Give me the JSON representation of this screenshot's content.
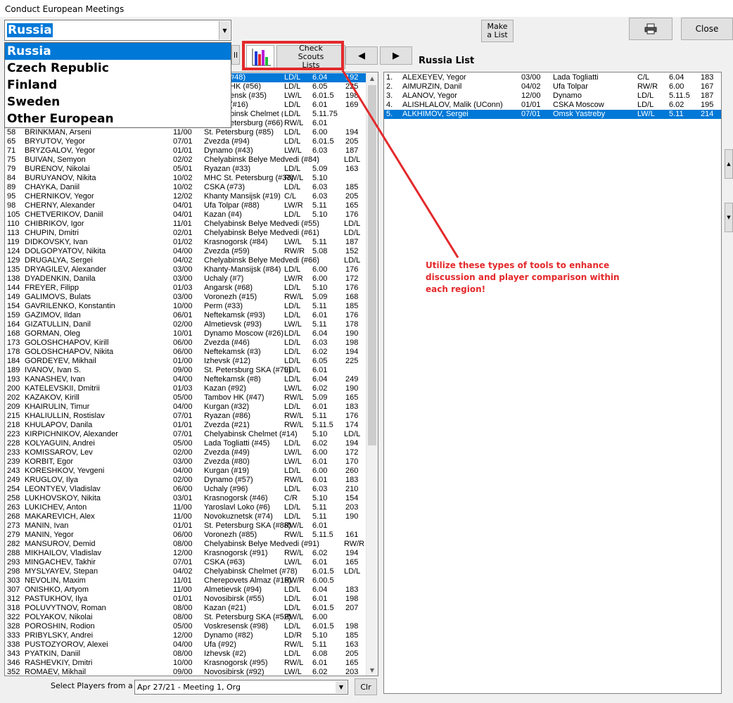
{
  "window": {
    "title": "Conduct European Meetings"
  },
  "region_combo": {
    "value": "Russia",
    "options": [
      "Russia",
      "Czech Republic",
      "Finland",
      "Sweden",
      "Other European"
    ]
  },
  "toolbar": {
    "make_list": "Make a List",
    "print_icon": "printer-icon",
    "close": "Close",
    "check_scouts": "Check Scouts Lists",
    "prev_icon": "triangle-left-icon",
    "next_icon": "triangle-right-icon",
    "all_label": "ll"
  },
  "colors": {
    "selection": "#0078d7",
    "annotation": "#e3292b"
  },
  "left_list": {
    "partial_rows": [
      {
        "team": "#48)",
        "pos": "LD/L",
        "ht": "6.04",
        "wt": "192",
        "selected": true
      },
      {
        "team": "HK (#56)",
        "pos": "LD/L",
        "ht": "6.05",
        "wt": "225"
      },
      {
        "team": "ensk (#35)",
        "pos": "LW/L",
        "ht": "6.01.5",
        "wt": "198"
      },
      {
        "team": "(#16)",
        "pos": "LD/L",
        "ht": "6.01",
        "wt": "169"
      },
      {
        "team": "binsk Chelmet (#96)",
        "pos": "LD/L",
        "ht": "5.11.75",
        "wt": ""
      },
      {
        "team": "etersburg (#66)",
        "pos": "RW/L",
        "ht": "6.01",
        "wt": ""
      }
    ],
    "rows": [
      {
        "num": "58",
        "name": "BRINKMAN, Arseni",
        "dob": "11/00",
        "team": "St. Petersburg (#85)",
        "pos": "LD/L",
        "ht": "6.00",
        "wt": "194"
      },
      {
        "num": "65",
        "name": "BRYUTOV, Yegor",
        "dob": "07/01",
        "team": "Zvezda (#94)",
        "pos": "LD/L",
        "ht": "6.01.5",
        "wt": "205"
      },
      {
        "num": "71",
        "name": "BRYZGALOV, Yegor",
        "dob": "01/01",
        "team": "Dynamo (#43)",
        "pos": "LW/L",
        "ht": "6.03",
        "wt": "187"
      },
      {
        "num": "75",
        "name": "BUIVAN, Semyon",
        "dob": "02/02",
        "team": "Chelyabinsk Belye Medvedi (#84)",
        "pos": "LD/L",
        "ht": "",
        "wt": ""
      },
      {
        "num": "79",
        "name": "BURENOV, Nikolai",
        "dob": "05/01",
        "team": "Ryazan (#33)",
        "pos": "LD/L",
        "ht": "5.09",
        "wt": "163"
      },
      {
        "num": "84",
        "name": "BURUYANOV, Nikita",
        "dob": "10/02",
        "team": "MHC St. Petersburg (#33)",
        "pos": "RW/L",
        "ht": "5.10",
        "wt": ""
      },
      {
        "num": "89",
        "name": "CHAYKA, Daniil",
        "dob": "10/02",
        "team": "CSKA (#73)",
        "pos": "LD/L",
        "ht": "6.03",
        "wt": "185"
      },
      {
        "num": "95",
        "name": "CHERNIKOV, Yegor",
        "dob": "12/02",
        "team": "Khanty Mansijsk (#19)",
        "pos": "C/L",
        "ht": "6.03",
        "wt": "205"
      },
      {
        "num": "98",
        "name": "CHERNY, Alexander",
        "dob": "04/01",
        "team": "Ufa Tolpar (#88)",
        "pos": "LW/R",
        "ht": "5.11",
        "wt": "165"
      },
      {
        "num": "105",
        "name": "CHETVERIKOV, Daniil",
        "dob": "04/01",
        "team": "Kazan (#4)",
        "pos": "LD/L",
        "ht": "5.10",
        "wt": "176"
      },
      {
        "num": "110",
        "name": "CHIBRIKOV, Igor",
        "dob": "11/01",
        "team": "Chelyabinsk Belye Medvedi (#55)",
        "pos": "LD/L",
        "ht": "",
        "wt": ""
      },
      {
        "num": "113",
        "name": "CHUPIN, Dmitri",
        "dob": "02/01",
        "team": "Chelyabinsk Belye Medvedi (#61)",
        "pos": "LD/L",
        "ht": "",
        "wt": ""
      },
      {
        "num": "119",
        "name": "DIDKOVSKY, Ivan",
        "dob": "01/02",
        "team": "Krasnogorsk (#84)",
        "pos": "LW/L",
        "ht": "5.11",
        "wt": "187"
      },
      {
        "num": "124",
        "name": "DOLGOPYATOV, Nikita",
        "dob": "04/00",
        "team": "Zvezda (#59)",
        "pos": "RW/R",
        "ht": "5.08",
        "wt": "152"
      },
      {
        "num": "129",
        "name": "DRUGALYA, Sergei",
        "dob": "04/02",
        "team": "Chelyabinsk Belye Medvedi (#66)",
        "pos": "LD/L",
        "ht": "",
        "wt": ""
      },
      {
        "num": "135",
        "name": "DRYAGILEV, Alexander",
        "dob": "03/00",
        "team": "Khanty-Mansijsk (#84)",
        "pos": "LD/L",
        "ht": "6.00",
        "wt": "176"
      },
      {
        "num": "138",
        "name": "DYADENKIN, Danila",
        "dob": "03/00",
        "team": "Uchaly (#7)",
        "pos": "LW/R",
        "ht": "6.00",
        "wt": "172"
      },
      {
        "num": "144",
        "name": "FREYER, Filipp",
        "dob": "01/03",
        "team": "Angarsk (#68)",
        "pos": "LD/L",
        "ht": "5.10",
        "wt": "176"
      },
      {
        "num": "149",
        "name": "GALIMOVS, Bulats",
        "dob": "03/00",
        "team": "Voronezh (#15)",
        "pos": "RW/L",
        "ht": "5.09",
        "wt": "168"
      },
      {
        "num": "154",
        "name": "GAVRILENKO, Konstantin",
        "dob": "10/00",
        "team": "Perm (#33)",
        "pos": "LD/L",
        "ht": "5.11",
        "wt": "185"
      },
      {
        "num": "159",
        "name": "GAZIMOV, Ildan",
        "dob": "06/01",
        "team": "Neftekamsk (#93)",
        "pos": "LD/L",
        "ht": "6.01",
        "wt": "176"
      },
      {
        "num": "164",
        "name": "GIZATULLIN, Danil",
        "dob": "02/00",
        "team": "Almetievsk (#93)",
        "pos": "LW/L",
        "ht": "5.11",
        "wt": "178"
      },
      {
        "num": "168",
        "name": "GORMAN, Oleg",
        "dob": "10/01",
        "team": "Dynamo Moscow (#26)",
        "pos": "LD/L",
        "ht": "6.04",
        "wt": "190"
      },
      {
        "num": "173",
        "name": "GOLOSHCHAPOV, Kirill",
        "dob": "06/00",
        "team": "Zvezda (#46)",
        "pos": "LD/L",
        "ht": "6.03",
        "wt": "198"
      },
      {
        "num": "178",
        "name": "GOLOSHCHAPOV, Nikita",
        "dob": "06/00",
        "team": "Neftekamsk (#3)",
        "pos": "LD/L",
        "ht": "6.02",
        "wt": "194"
      },
      {
        "num": "184",
        "name": "GORDEYEV, Mikhail",
        "dob": "01/00",
        "team": "Izhevsk (#12)",
        "pos": "LD/L",
        "ht": "6.05",
        "wt": "225"
      },
      {
        "num": "189",
        "name": "IVANOV, Ivan S.",
        "dob": "09/00",
        "team": "St. Petersburg SKA (#79)",
        "pos": "LD/L",
        "ht": "6.01",
        "wt": ""
      },
      {
        "num": "193",
        "name": "KANASHEV, Ivan",
        "dob": "04/00",
        "team": "Neftekamsk (#8)",
        "pos": "LD/L",
        "ht": "6.04",
        "wt": "249"
      },
      {
        "num": "200",
        "name": "KATELEVSKII, Dmitrii",
        "dob": "01/03",
        "team": "Kazan (#92)",
        "pos": "LW/L",
        "ht": "6.02",
        "wt": "190"
      },
      {
        "num": "202",
        "name": "KAZAKOV, Kirill",
        "dob": "05/00",
        "team": "Tambov HK (#47)",
        "pos": "RW/L",
        "ht": "5.09",
        "wt": "165"
      },
      {
        "num": "209",
        "name": "KHAIRULIN, Timur",
        "dob": "04/00",
        "team": "Kurgan (#32)",
        "pos": "LD/L",
        "ht": "6.01",
        "wt": "183"
      },
      {
        "num": "215",
        "name": "KHALIULLIN, Rostislav",
        "dob": "07/01",
        "team": "Ryazan (#86)",
        "pos": "RW/L",
        "ht": "5.11",
        "wt": "176"
      },
      {
        "num": "218",
        "name": "KHULAPOV, Danila",
        "dob": "01/01",
        "team": "Zvezda (#21)",
        "pos": "RW/L",
        "ht": "5.11.5",
        "wt": "174"
      },
      {
        "num": "223",
        "name": "KIRPICHNIKOV, Alexander",
        "dob": "07/01",
        "team": "Chelyabinsk Chelmet (#14)",
        "pos": "LD/L",
        "ht": "5.10",
        "wt": ""
      },
      {
        "num": "228",
        "name": "KOLYAGUIN, Andrei",
        "dob": "05/00",
        "team": "Lada Togliatti (#45)",
        "pos": "LD/L",
        "ht": "6.02",
        "wt": "194"
      },
      {
        "num": "233",
        "name": "KOMISSAROV, Lev",
        "dob": "02/00",
        "team": "Zvezda (#49)",
        "pos": "LW/L",
        "ht": "6.00",
        "wt": "172"
      },
      {
        "num": "239",
        "name": "KORBIT, Egor",
        "dob": "03/00",
        "team": "Zvezda (#80)",
        "pos": "LW/L",
        "ht": "6.01",
        "wt": "170"
      },
      {
        "num": "243",
        "name": "KORESHKOV, Yevgeni",
        "dob": "04/00",
        "team": "Kurgan (#19)",
        "pos": "LD/L",
        "ht": "6.00",
        "wt": "260"
      },
      {
        "num": "249",
        "name": "KRUGLOV, Ilya",
        "dob": "02/00",
        "team": "Dynamo (#57)",
        "pos": "RW/L",
        "ht": "6.01",
        "wt": "183"
      },
      {
        "num": "254",
        "name": "LEONTYEV, Vladislav",
        "dob": "06/00",
        "team": "Uchaly (#96)",
        "pos": "LD/L",
        "ht": "6.03",
        "wt": "210"
      },
      {
        "num": "258",
        "name": "LUKHOVSKOY, Nikita",
        "dob": "03/01",
        "team": "Krasnogorsk (#46)",
        "pos": "C/R",
        "ht": "5.10",
        "wt": "154"
      },
      {
        "num": "263",
        "name": "LUKICHEV, Anton",
        "dob": "11/00",
        "team": "Yaroslavl Loko (#6)",
        "pos": "LD/L",
        "ht": "5.11",
        "wt": "203"
      },
      {
        "num": "268",
        "name": "MAKAREVICH, Alex",
        "dob": "11/00",
        "team": "Novokuznetsk (#74)",
        "pos": "LD/L",
        "ht": "5.11",
        "wt": "190"
      },
      {
        "num": "273",
        "name": "MANIN, Ivan",
        "dob": "01/01",
        "team": "St. Petersburg SKA (#88)",
        "pos": "RW/L",
        "ht": "6.01",
        "wt": ""
      },
      {
        "num": "279",
        "name": "MANIN, Yegor",
        "dob": "06/00",
        "team": "Voronezh (#85)",
        "pos": "RW/L",
        "ht": "5.11.5",
        "wt": "161"
      },
      {
        "num": "282",
        "name": "MANSUROV, Demid",
        "dob": "08/00",
        "team": "Chelyabinsk Belye Medvedi (#91)",
        "pos": "RW/R",
        "ht": "",
        "wt": ""
      },
      {
        "num": "288",
        "name": "MIKHAILOV, Vladislav",
        "dob": "12/00",
        "team": "Krasnogorsk (#91)",
        "pos": "RW/L",
        "ht": "6.02",
        "wt": "194"
      },
      {
        "num": "293",
        "name": "MINGACHEV, Takhir",
        "dob": "07/01",
        "team": "CSKA (#63)",
        "pos": "LW/L",
        "ht": "6.01",
        "wt": "165"
      },
      {
        "num": "298",
        "name": "MYSLYAYEV, Stepan",
        "dob": "04/02",
        "team": "Chelyabinsk Chelmet (#78)",
        "pos": "LD/L",
        "ht": "6.01.5",
        "wt": ""
      },
      {
        "num": "303",
        "name": "NEVOLIN, Maxim",
        "dob": "11/01",
        "team": "Cherepovets Almaz (#16)",
        "pos": "RW/R",
        "ht": "6.00.5",
        "wt": ""
      },
      {
        "num": "307",
        "name": "ONISHKO, Artyom",
        "dob": "11/00",
        "team": "Almetievsk (#94)",
        "pos": "LD/L",
        "ht": "6.04",
        "wt": "183"
      },
      {
        "num": "312",
        "name": "PASTUKHOV, Ilya",
        "dob": "01/01",
        "team": "Novosibirsk (#55)",
        "pos": "LD/L",
        "ht": "6.01",
        "wt": "198"
      },
      {
        "num": "318",
        "name": "POLUVYTNOV, Roman",
        "dob": "08/00",
        "team": "Kazan (#21)",
        "pos": "LD/L",
        "ht": "6.01.5",
        "wt": "207"
      },
      {
        "num": "322",
        "name": "POLYAKOV, Nikolai",
        "dob": "08/00",
        "team": "St. Petersburg SKA (#52)",
        "pos": "RW/L",
        "ht": "6.00",
        "wt": ""
      },
      {
        "num": "328",
        "name": "POROSHIN, Rodion",
        "dob": "05/00",
        "team": "Voskresensk (#98)",
        "pos": "LD/L",
        "ht": "6.01.5",
        "wt": "198"
      },
      {
        "num": "333",
        "name": "PRIBYLSKY, Andrei",
        "dob": "12/00",
        "team": "Dynamo (#82)",
        "pos": "LD/R",
        "ht": "5.10",
        "wt": "185"
      },
      {
        "num": "338",
        "name": "PUSTOZYOROV, Alexei",
        "dob": "04/00",
        "team": "Ufa (#92)",
        "pos": "RW/L",
        "ht": "5.11",
        "wt": "163"
      },
      {
        "num": "343",
        "name": "PYATKIN, Daniil",
        "dob": "08/00",
        "team": "Izhevsk (#2)",
        "pos": "LD/L",
        "ht": "6.08",
        "wt": "205"
      },
      {
        "num": "346",
        "name": "RASHEVKIY, Dmitri",
        "dob": "10/00",
        "team": "Krasnogorsk (#95)",
        "pos": "RW/L",
        "ht": "6.01",
        "wt": "165"
      },
      {
        "num": "352",
        "name": "ROMAEV, Mikhail",
        "dob": "09/00",
        "team": "Novosibirsk (#92)",
        "pos": "LW/L",
        "ht": "6.02",
        "wt": "203"
      }
    ]
  },
  "right_list": {
    "title": "Russia List",
    "rows": [
      {
        "num": "1.",
        "name": "ALEXEYEV, Yegor",
        "dob": "03/00",
        "team": "Lada Togliatti",
        "pos": "C/L",
        "ht": "6.04",
        "wt": "183"
      },
      {
        "num": "2.",
        "name": "AIMURZIN, Danil",
        "dob": "04/02",
        "team": "Ufa Tolpar",
        "pos": "RW/R",
        "ht": "6.00",
        "wt": "167"
      },
      {
        "num": "3.",
        "name": "ALANOV, Yegor",
        "dob": "12/00",
        "team": "Dynamo",
        "pos": "LD/L",
        "ht": "5.11.5",
        "wt": "187"
      },
      {
        "num": "4.",
        "name": "ALISHLALOV, Malik (UConn)",
        "dob": "01/01",
        "team": "CSKA Moscow",
        "pos": "LD/L",
        "ht": "6.02",
        "wt": "195"
      },
      {
        "num": "5.",
        "name": "ALKHIMOV, Sergei",
        "dob": "07/01",
        "team": "Omsk Yastreby",
        "pos": "LW/L",
        "ht": "5.11",
        "wt": "214",
        "selected": true
      }
    ]
  },
  "footer": {
    "label": "Select Players from a List",
    "meeting_select": "Apr 27/21 - Meeting 1, Org",
    "clear": "Clr"
  },
  "annotation": {
    "text": "Utilize these types of tools to enhance discussion and player comparison within each region!"
  }
}
